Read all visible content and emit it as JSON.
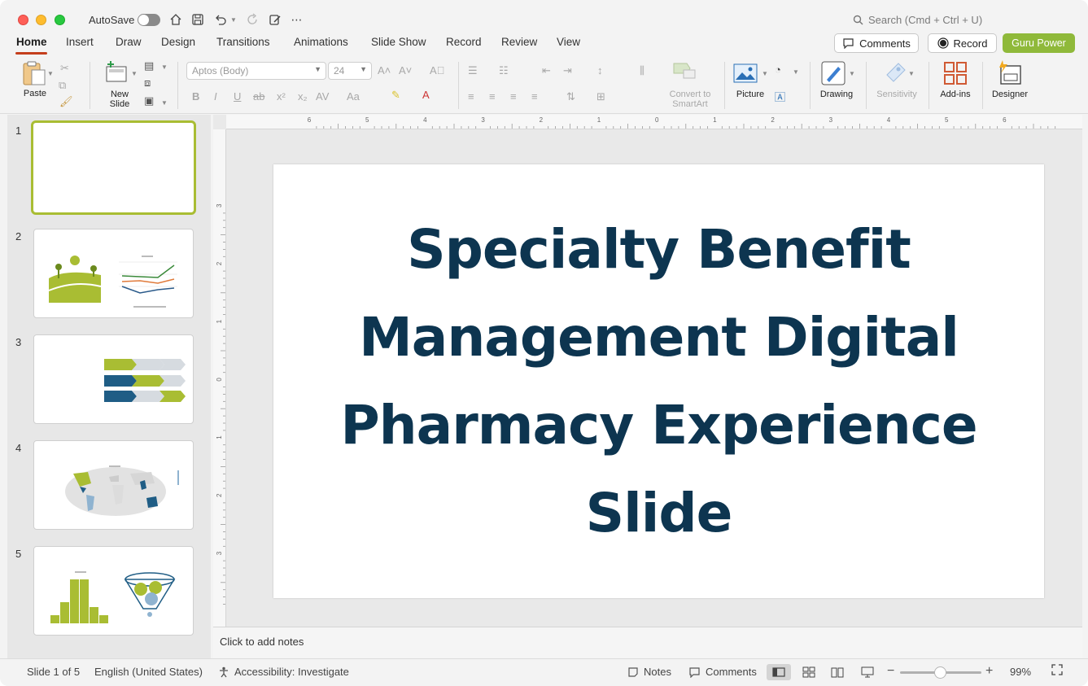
{
  "window": {
    "autosave_label": "AutoSave",
    "search_placeholder": "Search (Cmd + Ctrl + U)"
  },
  "tabs": [
    "Home",
    "Insert",
    "Draw",
    "Design",
    "Transitions",
    "Animations",
    "Slide Show",
    "Record",
    "Review",
    "View"
  ],
  "header_buttons": {
    "comments": "Comments",
    "record": "Record",
    "guru": "Guru Power"
  },
  "ribbon": {
    "paste": "Paste",
    "new_slide_line1": "New",
    "new_slide_line2": "Slide",
    "font_name": "Aptos (Body)",
    "font_size": "24",
    "convert_line1": "Convert to",
    "convert_line2": "SmartArt",
    "picture": "Picture",
    "drawing": "Drawing",
    "sensitivity": "Sensitivity",
    "addins": "Add-ins",
    "designer": "Designer"
  },
  "thumbnails": [
    {
      "number": "1"
    },
    {
      "number": "2"
    },
    {
      "number": "3"
    },
    {
      "number": "4"
    },
    {
      "number": "5"
    }
  ],
  "ruler": {
    "h_labels": [
      "6",
      "5",
      "4",
      "3",
      "2",
      "1",
      "0",
      "1",
      "2",
      "3",
      "4",
      "5",
      "6"
    ],
    "v_labels": [
      "3",
      "2",
      "1",
      "0",
      "1",
      "2",
      "3"
    ]
  },
  "slide": {
    "title": "Specialty Benefit Management Digital Pharmacy Experience Slide"
  },
  "notes": {
    "placeholder": "Click to add notes"
  },
  "status": {
    "slide_of": "Slide 1 of 5",
    "language": "English (United States)",
    "accessibility": "Accessibility: Investigate",
    "notes": "Notes",
    "comments": "Comments",
    "zoom": "99%"
  },
  "colors": {
    "title_text": "#0d3550",
    "accent_green": "#a9bd33",
    "tab_underline": "#c43e1c",
    "guru_button": "#8fb93a"
  }
}
